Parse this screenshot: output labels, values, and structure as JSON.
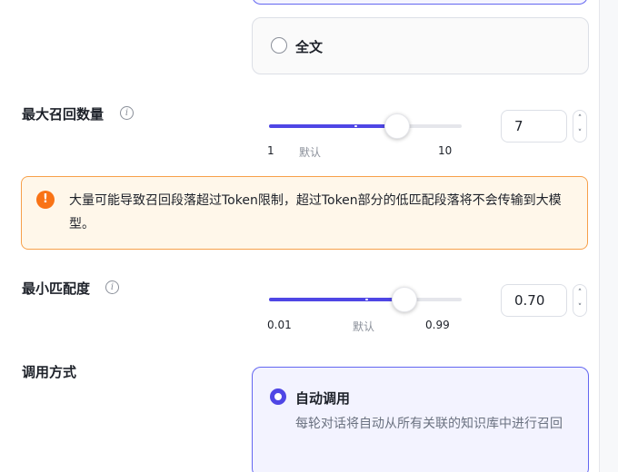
{
  "recall_scope": {
    "fulltext_label": "全文"
  },
  "max_recall": {
    "label": "最大召回数量",
    "info_glyph": "i",
    "min_label": "1",
    "default_label": "默认",
    "max_label": "10",
    "value": "7",
    "min": 1,
    "max": 10,
    "default": 5
  },
  "warning": {
    "text": "大量可能导致召回段落超过Token限制，超过Token部分的低匹配段落将不会传输到大模型。",
    "icon_glyph": "!",
    "color": "#f97316"
  },
  "min_match": {
    "label": "最小匹配度",
    "info_glyph": "i",
    "min_label": "0.01",
    "default_label": "默认",
    "max_label": "0.99",
    "value": "0.70",
    "min": 0.01,
    "max": 0.99,
    "default": 0.5
  },
  "call_mode": {
    "label": "调用方式",
    "auto_title": "自动调用",
    "auto_desc": "每轮对话将自动从所有关联的知识库中进行召回"
  },
  "stepper": {
    "up_glyph": "˄",
    "down_glyph": "˅"
  },
  "colors": {
    "accent": "#4f46e5",
    "warning_border": "#f7a04a",
    "warning_bg": "#fff7ea"
  }
}
